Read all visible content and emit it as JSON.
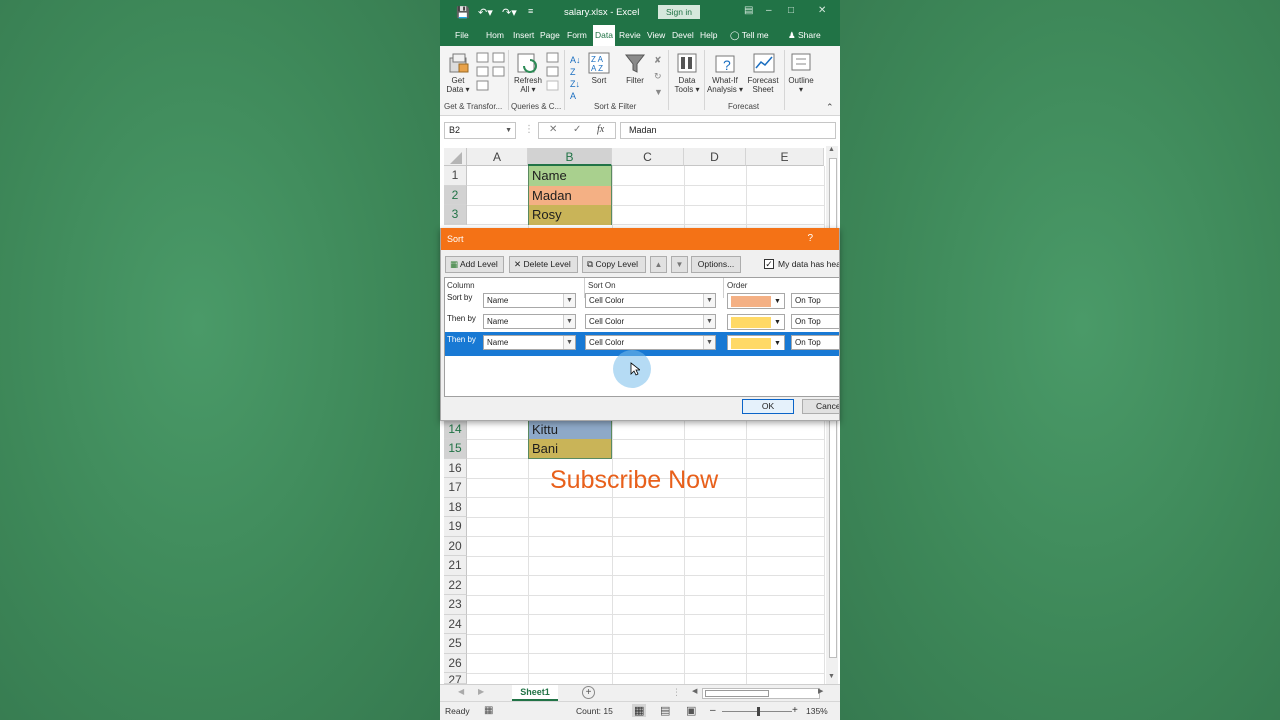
{
  "window": {
    "title": "salary.xlsx  -  Excel",
    "signin_label": "Sign in"
  },
  "tabs": [
    "File",
    "Hom",
    "Insert",
    "Page",
    "Form",
    "Data",
    "Revie",
    "View",
    "Devel",
    "Help"
  ],
  "tell_me": "Tell me",
  "share": "Share",
  "ribbon": {
    "get_data": [
      "Get",
      "Data"
    ],
    "refresh": [
      "Refresh",
      "All"
    ],
    "sort": "Sort",
    "filter": "Filter",
    "data_tools": [
      "Data",
      "Tools"
    ],
    "what_if": [
      "What-If",
      "Analysis"
    ],
    "forecast_sheet": [
      "Forecast",
      "Sheet"
    ],
    "outline": "Outline",
    "groups": [
      "Get & Transfor...",
      "Queries & C...",
      "Sort & Filter",
      "Forecast"
    ]
  },
  "formula_bar": {
    "name_box": "B2",
    "fx": "fx",
    "value": "Madan"
  },
  "columns": [
    "A",
    "B",
    "C",
    "D",
    "E"
  ],
  "rows_top": [
    "1",
    "2",
    "3"
  ],
  "rows_bottom": [
    "14",
    "15",
    "16",
    "17",
    "18",
    "19",
    "20",
    "21",
    "22",
    "23",
    "24",
    "25",
    "26",
    "27"
  ],
  "cells": {
    "b1": {
      "text": "Name",
      "color": "#a9d08e"
    },
    "b2": {
      "text": "Madan",
      "color": "#f4b084"
    },
    "b3": {
      "text": "Rosy",
      "color": "#c9b458"
    },
    "b14": {
      "text": "Kittu",
      "color": "#8ea9c8"
    },
    "b15": {
      "text": "Bani",
      "color": "#c9b458"
    }
  },
  "overlay_text": "Subscribe Now",
  "sheet_tab": "Sheet1",
  "status": {
    "ready": "Ready",
    "count": "Count: 15",
    "zoom": "135%"
  },
  "sort_dialog": {
    "title": "Sort",
    "help": "?",
    "add_level": "Add Level",
    "delete_level": "Delete Level",
    "copy_level": "Copy Level",
    "options": "Options...",
    "header_checkbox": "My data has hea",
    "col_headers": {
      "column": "Column",
      "sort_on": "Sort On",
      "order": "Order"
    },
    "levels": [
      {
        "label": "Sort by",
        "column": "Name",
        "sort_on": "Cell Color",
        "color": "#f4b084",
        "position": "On Top"
      },
      {
        "label": "Then by",
        "column": "Name",
        "sort_on": "Cell Color",
        "color": "#ffd966",
        "position": "On Top"
      },
      {
        "label": "Then by",
        "column": "Name",
        "sort_on": "Cell Color",
        "color": "#ffd966",
        "position": "On Top"
      }
    ],
    "ok": "OK",
    "cancel": "Cancel"
  }
}
